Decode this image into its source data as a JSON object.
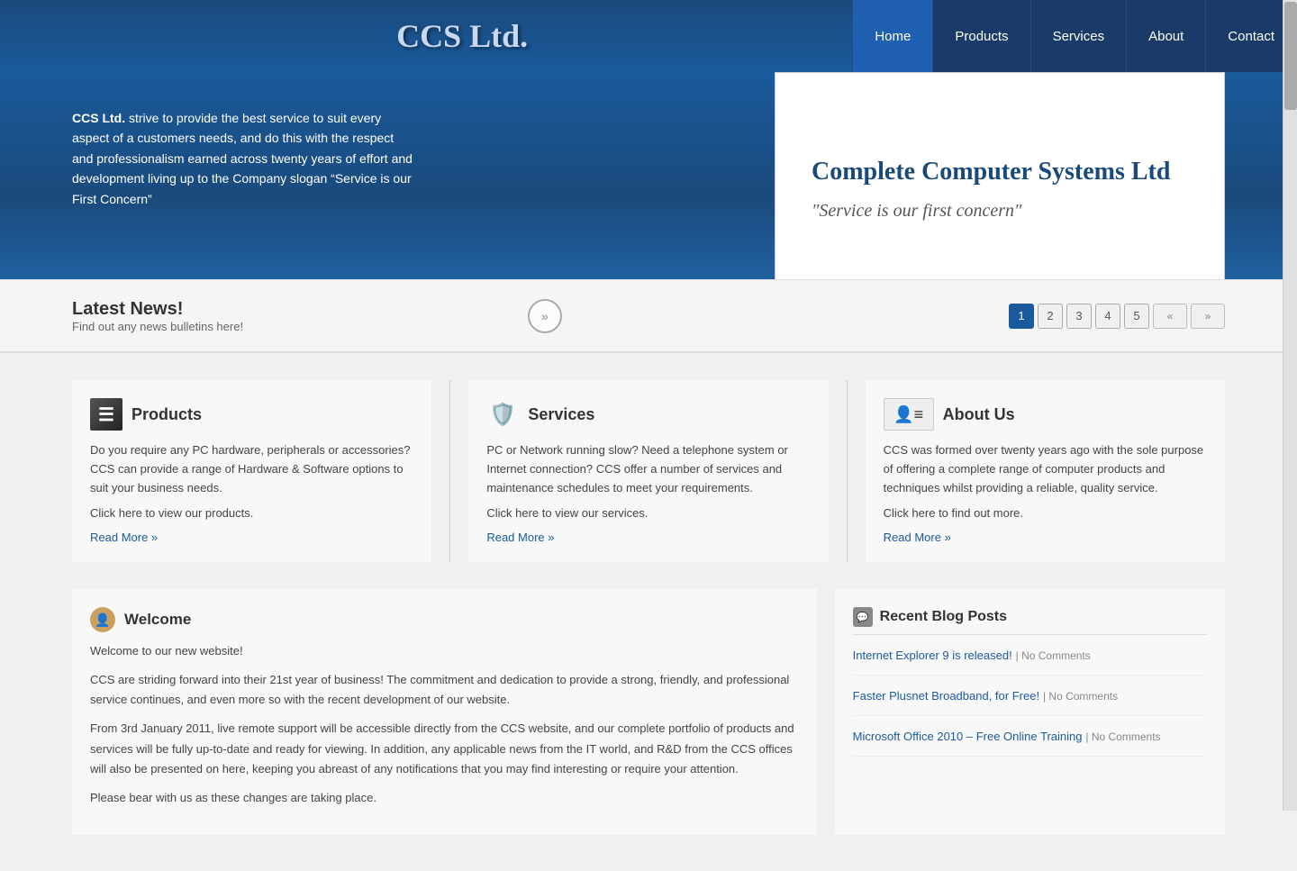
{
  "header": {
    "logo": "CCS Ltd.",
    "nav": {
      "home": "Home",
      "products": "Products",
      "services": "Services",
      "about": "About",
      "contact": "Contact"
    }
  },
  "hero": {
    "intro_bold": "CCS Ltd.",
    "intro_text": " strive to provide the best service to suit every aspect of a customers needs, and do this with the respect and professionalism earned across twenty years of effort and development living up to the Company slogan “Service is our First Concern”",
    "slide_title": "Complete Computer Systems Ltd",
    "slide_subtitle": "\"Service is our first concern\""
  },
  "news_bar": {
    "title": "Latest News!",
    "subtitle": "Find out any news bulletins here!"
  },
  "slide_pagination": {
    "pages": [
      "1",
      "2",
      "3",
      "4",
      "5"
    ],
    "active": "1"
  },
  "products_section": {
    "title": "Products",
    "body1": "Do you require any PC hardware, peripherals or accessories? CCS can provide a range of Hardware & Software options to suit your business needs.",
    "body2": "Click here to view our products.",
    "read_more": "Read More »"
  },
  "services_section": {
    "title": "Services",
    "body1": "PC or Network running slow? Need a telephone system or Internet connection? CCS offer a number of services and maintenance schedules to meet your requirements.",
    "body2": "Click here to view our services.",
    "read_more": "Read More »"
  },
  "about_section": {
    "title": "About Us",
    "body1": "CCS was formed over twenty years ago with the sole purpose of offering a complete range of computer products and techniques whilst providing a reliable, quality service.",
    "body2": "Click here to find out more.",
    "read_more": "Read More »"
  },
  "welcome": {
    "title": "Welcome",
    "subtitle": "Welcome to our new website!",
    "para1": "CCS are striding forward into their 21st year of business! The commitment and dedication to provide a strong, friendly, and professional service continues, and even more so with the recent development of our website.",
    "para2": "From 3rd January 2011, live remote support will be accessible directly from the CCS website, and our complete portfolio of products and services will be fully up-to-date and ready for viewing. In addition, any applicable news from the IT world, and R&D from the CCS offices will also be presented on here, keeping you abreast of any notifications that you may find interesting or require your attention.",
    "para3": "Please bear with us as these changes are taking place."
  },
  "blog": {
    "title": "Recent Blog Posts",
    "posts": [
      {
        "link": "Internet Explorer 9 is released!",
        "pipe": " | ",
        "comment": "No Comments"
      },
      {
        "link": "Faster Plusnet Broadband, for Free!",
        "pipe": " | ",
        "comment": "No Comments"
      },
      {
        "link": "Microsoft Office 2010 – Free Online Training",
        "pipe": " | ",
        "comment": "No Comments"
      }
    ]
  }
}
